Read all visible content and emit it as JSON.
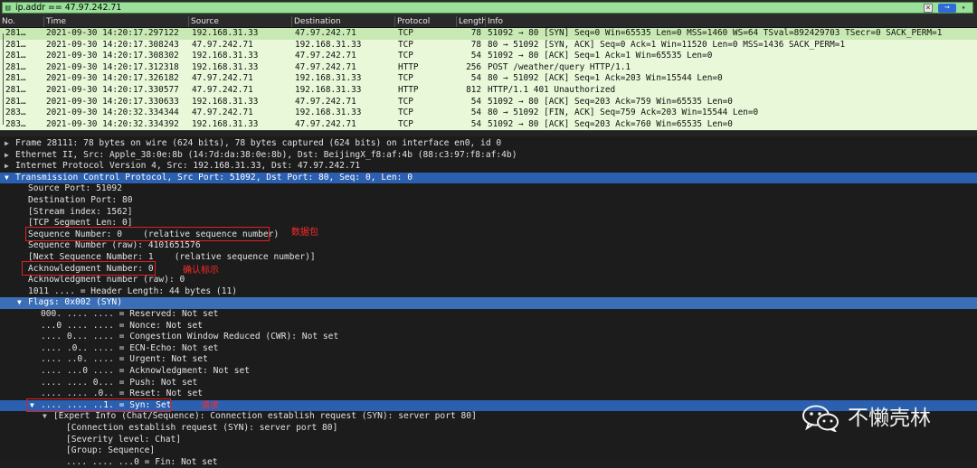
{
  "filter": {
    "value": "ip.addr == 47.97.242.71",
    "clear_label": "×",
    "apply_label": "➞",
    "dropdown_label": "▾",
    "bookmark_icon": "bookmark-icon"
  },
  "columns": [
    "No.",
    "Time",
    "Source",
    "Destination",
    "Protocol",
    "Length",
    "Info"
  ],
  "packets": [
    {
      "no": "281…",
      "time": "2021-09-30 14:20:17.297122",
      "src": "192.168.31.33",
      "dst": "47.97.242.71",
      "proto": "TCP",
      "len": "78",
      "info": "51092 → 80 [SYN] Seq=0 Win=65535 Len=0 MSS=1460 WS=64 TSval=892429703 TSecr=0 SACK_PERM=1"
    },
    {
      "no": "281…",
      "time": "2021-09-30 14:20:17.308243",
      "src": "47.97.242.71",
      "dst": "192.168.31.33",
      "proto": "TCP",
      "len": "78",
      "info": "80 → 51092 [SYN, ACK] Seq=0 Ack=1 Win=11520 Len=0 MSS=1436 SACK_PERM=1"
    },
    {
      "no": "281…",
      "time": "2021-09-30 14:20:17.308302",
      "src": "192.168.31.33",
      "dst": "47.97.242.71",
      "proto": "TCP",
      "len": "54",
      "info": "51092 → 80 [ACK] Seq=1 Ack=1 Win=65535 Len=0"
    },
    {
      "no": "281…",
      "time": "2021-09-30 14:20:17.312318",
      "src": "192.168.31.33",
      "dst": "47.97.242.71",
      "proto": "HTTP",
      "len": "256",
      "info": "POST /weather/query HTTP/1.1"
    },
    {
      "no": "281…",
      "time": "2021-09-30 14:20:17.326182",
      "src": "47.97.242.71",
      "dst": "192.168.31.33",
      "proto": "TCP",
      "len": "54",
      "info": "80 → 51092 [ACK] Seq=1 Ack=203 Win=15544 Len=0"
    },
    {
      "no": "281…",
      "time": "2021-09-30 14:20:17.330577",
      "src": "47.97.242.71",
      "dst": "192.168.31.33",
      "proto": "HTTP",
      "len": "812",
      "info": "HTTP/1.1 401 Unauthorized"
    },
    {
      "no": "281…",
      "time": "2021-09-30 14:20:17.330633",
      "src": "192.168.31.33",
      "dst": "47.97.242.71",
      "proto": "TCP",
      "len": "54",
      "info": "51092 → 80 [ACK] Seq=203 Ack=759 Win=65535 Len=0"
    },
    {
      "no": "283…",
      "time": "2021-09-30 14:20:32.334344",
      "src": "47.97.242.71",
      "dst": "192.168.31.33",
      "proto": "TCP",
      "len": "54",
      "info": "80 → 51092 [FIN, ACK] Seq=759 Ack=203 Win=15544 Len=0"
    },
    {
      "no": "283…",
      "time": "2021-09-30 14:20:32.334392",
      "src": "192.168.31.33",
      "dst": "47.97.242.71",
      "proto": "TCP",
      "len": "54",
      "info": "51092 → 80 [ACK] Seq=203 Ack=760 Win=65535 Len=0"
    }
  ],
  "details": [
    {
      "arrow": "▶",
      "text": "Frame 28111: 78 bytes on wire (624 bits), 78 bytes captured (624 bits) on interface en0, id 0"
    },
    {
      "arrow": "▶",
      "text": "Ethernet II, Src: Apple_38:0e:8b (14:7d:da:38:0e:8b), Dst: BeijingX_f8:af:4b (88:c3:97:f8:af:4b)"
    },
    {
      "arrow": "▶",
      "text": "Internet Protocol Version 4, Src: 192.168.31.33, Dst: 47.97.242.71"
    },
    {
      "arrow": "▼",
      "text": "Transmission Control Protocol, Src Port: 51092, Dst Port: 80, Seq: 0, Len: 0"
    },
    {
      "arrow": "",
      "text": "Source Port: 51092"
    },
    {
      "arrow": "",
      "text": "Destination Port: 80"
    },
    {
      "arrow": "",
      "text": "[Stream index: 1562]"
    },
    {
      "arrow": "",
      "text": "[TCP Segment Len: 0]"
    },
    {
      "arrow": "",
      "text": "Sequence Number: 0    (relative sequence number)"
    },
    {
      "arrow": "",
      "text": "Sequence Number (raw): 4101651576"
    },
    {
      "arrow": "",
      "text": "[Next Sequence Number: 1    (relative sequence number)]"
    },
    {
      "arrow": "",
      "text": "Acknowledgment Number: 0"
    },
    {
      "arrow": "",
      "text": "Acknowledgment number (raw): 0"
    },
    {
      "arrow": "",
      "text": "1011 .... = Header Length: 44 bytes (11)"
    },
    {
      "arrow": "▼",
      "text": "Flags: 0x002 (SYN)"
    },
    {
      "arrow": "",
      "text": "000. .... .... = Reserved: Not set"
    },
    {
      "arrow": "",
      "text": "...0 .... .... = Nonce: Not set"
    },
    {
      "arrow": "",
      "text": ".... 0... .... = Congestion Window Reduced (CWR): Not set"
    },
    {
      "arrow": "",
      "text": ".... .0.. .... = ECN-Echo: Not set"
    },
    {
      "arrow": "",
      "text": ".... ..0. .... = Urgent: Not set"
    },
    {
      "arrow": "",
      "text": ".... ...0 .... = Acknowledgment: Not set"
    },
    {
      "arrow": "",
      "text": ".... .... 0... = Push: Not set"
    },
    {
      "arrow": "",
      "text": ".... .... .0.. = Reset: Not set"
    },
    {
      "arrow": "▼",
      "text": ".... .... ..1. = Syn: Set"
    },
    {
      "arrow": "▼",
      "text": "[Expert Info (Chat/Sequence): Connection establish request (SYN): server port 80]"
    },
    {
      "arrow": "",
      "text": "[Connection establish request (SYN): server port 80]"
    },
    {
      "arrow": "",
      "text": "[Severity level: Chat]"
    },
    {
      "arrow": "",
      "text": "[Group: Sequence]"
    },
    {
      "arrow": "",
      "text": ".... .... ...0 = Fin: Not set"
    }
  ],
  "annotations": {
    "packet": "数据包",
    "ack_flag": "确认标示",
    "syn": "请求"
  },
  "watermark": {
    "text": "不懒壳林",
    "icon": "wechat-icon"
  },
  "colors": {
    "packet_bg": "#e8f8d8",
    "filter_bg": "#9ae09a",
    "selected_detail": "#2b5fb0",
    "annotation": "#ff2a2a"
  }
}
